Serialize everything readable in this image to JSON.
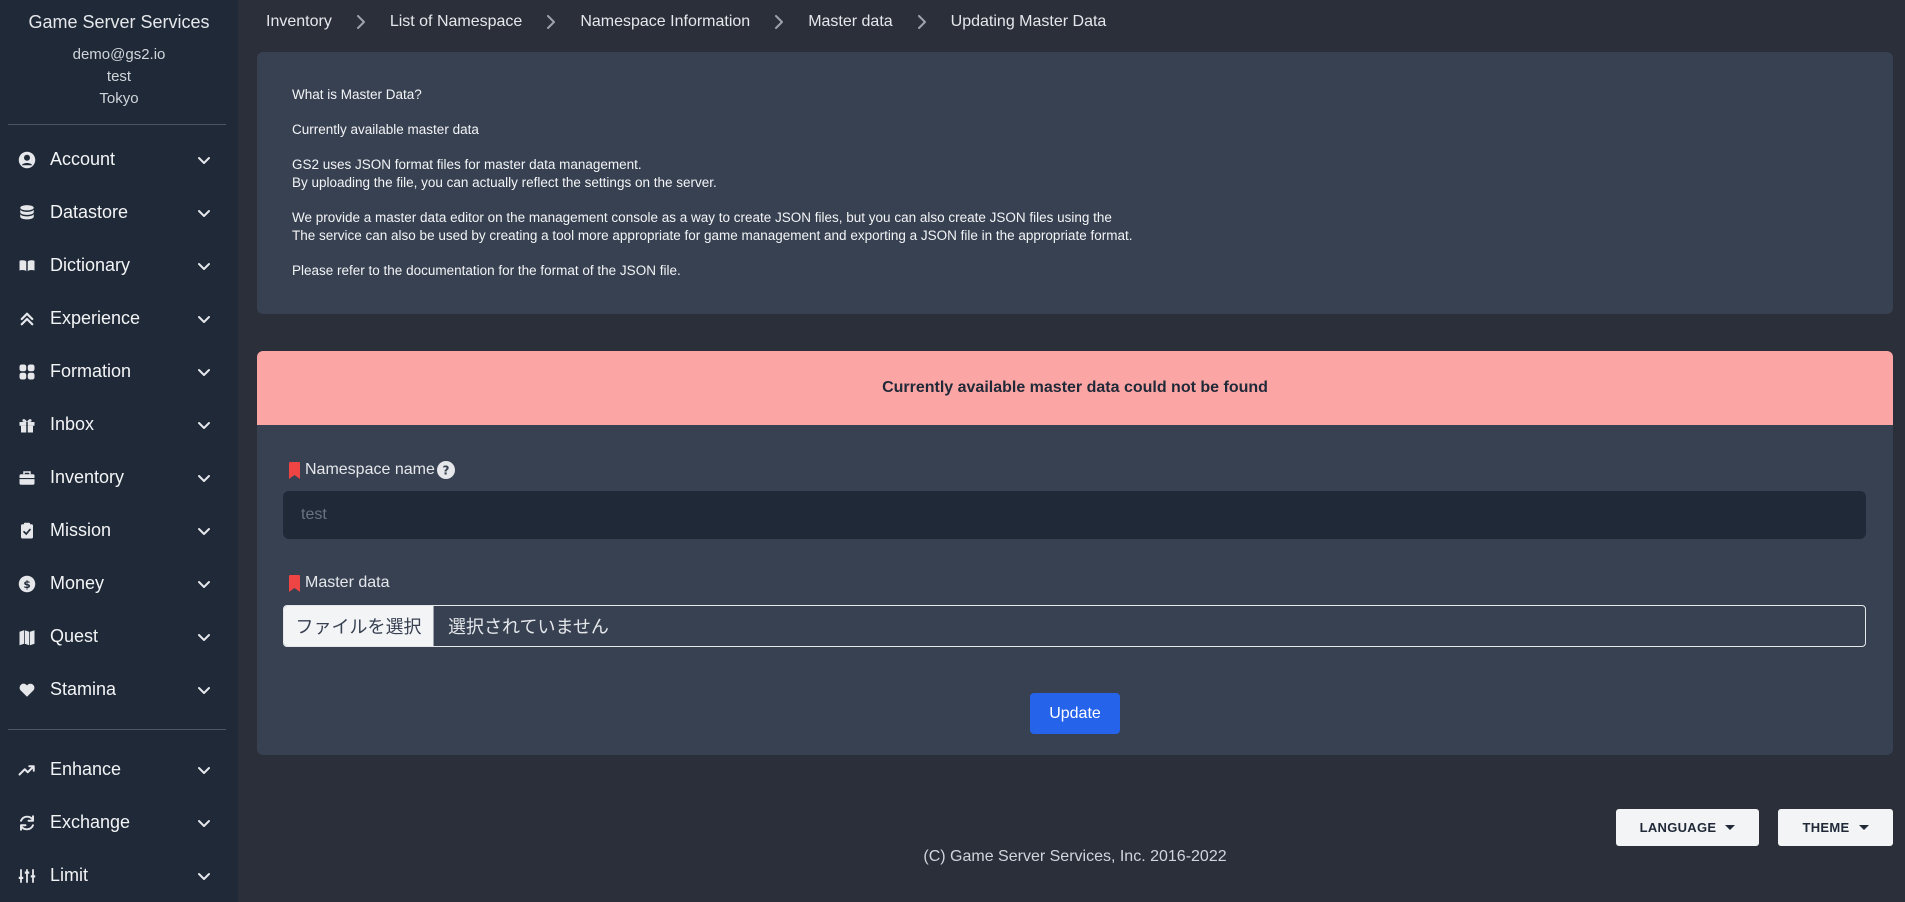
{
  "sidebar": {
    "title": "Game Server Services",
    "email": "demo@gs2.io",
    "project": "test",
    "region": "Tokyo",
    "items": [
      {
        "label": "Account",
        "icon": "user-circle-icon"
      },
      {
        "label": "Datastore",
        "icon": "database-icon"
      },
      {
        "label": "Dictionary",
        "icon": "book-open-icon"
      },
      {
        "label": "Experience",
        "icon": "chevrons-up-icon"
      },
      {
        "label": "Formation",
        "icon": "grid-icon"
      },
      {
        "label": "Inbox",
        "icon": "gift-icon"
      },
      {
        "label": "Inventory",
        "icon": "briefcase-icon"
      },
      {
        "label": "Mission",
        "icon": "clipboard-check-icon"
      },
      {
        "label": "Money",
        "icon": "dollar-circle-icon"
      },
      {
        "label": "Quest",
        "icon": "map-icon"
      },
      {
        "label": "Stamina",
        "icon": "heart-icon"
      }
    ],
    "items2": [
      {
        "label": "Enhance",
        "icon": "trending-up-icon"
      },
      {
        "label": "Exchange",
        "icon": "refresh-icon"
      },
      {
        "label": "Limit",
        "icon": "sliders-icon"
      }
    ]
  },
  "breadcrumb": [
    "Inventory",
    "List of Namespace",
    "Namespace Information",
    "Master data",
    "Updating Master Data"
  ],
  "info": {
    "what": "What is Master Data?",
    "current": "Currently available master data",
    "p1a": "GS2 uses JSON format files for master data management.",
    "p1b": "By uploading the file, you can actually reflect the settings on the server.",
    "p2a": "We provide a master data editor on the management console as a way to create JSON files, but you can also create JSON files using the",
    "p2b": "The service can also be used by creating a tool more appropriate for game management and exporting a JSON file in the appropriate format.",
    "p3": "Please refer to the documentation for the format of the JSON file."
  },
  "alert": "Currently available master data could not be found",
  "form": {
    "namespace_label": "Namespace name",
    "namespace_placeholder": "test",
    "master_label": "Master data",
    "file_button": "ファイルを選択",
    "file_status": "選択されていません",
    "update": "Update"
  },
  "footer": {
    "language": "LANGUAGE",
    "theme": "THEME",
    "copyright": "(C) Game Server Services, Inc. 2016-2022"
  },
  "colors": {
    "accent": "#2563eb",
    "alert_bg": "#fca5a5",
    "required_marker": "#ef4444"
  }
}
